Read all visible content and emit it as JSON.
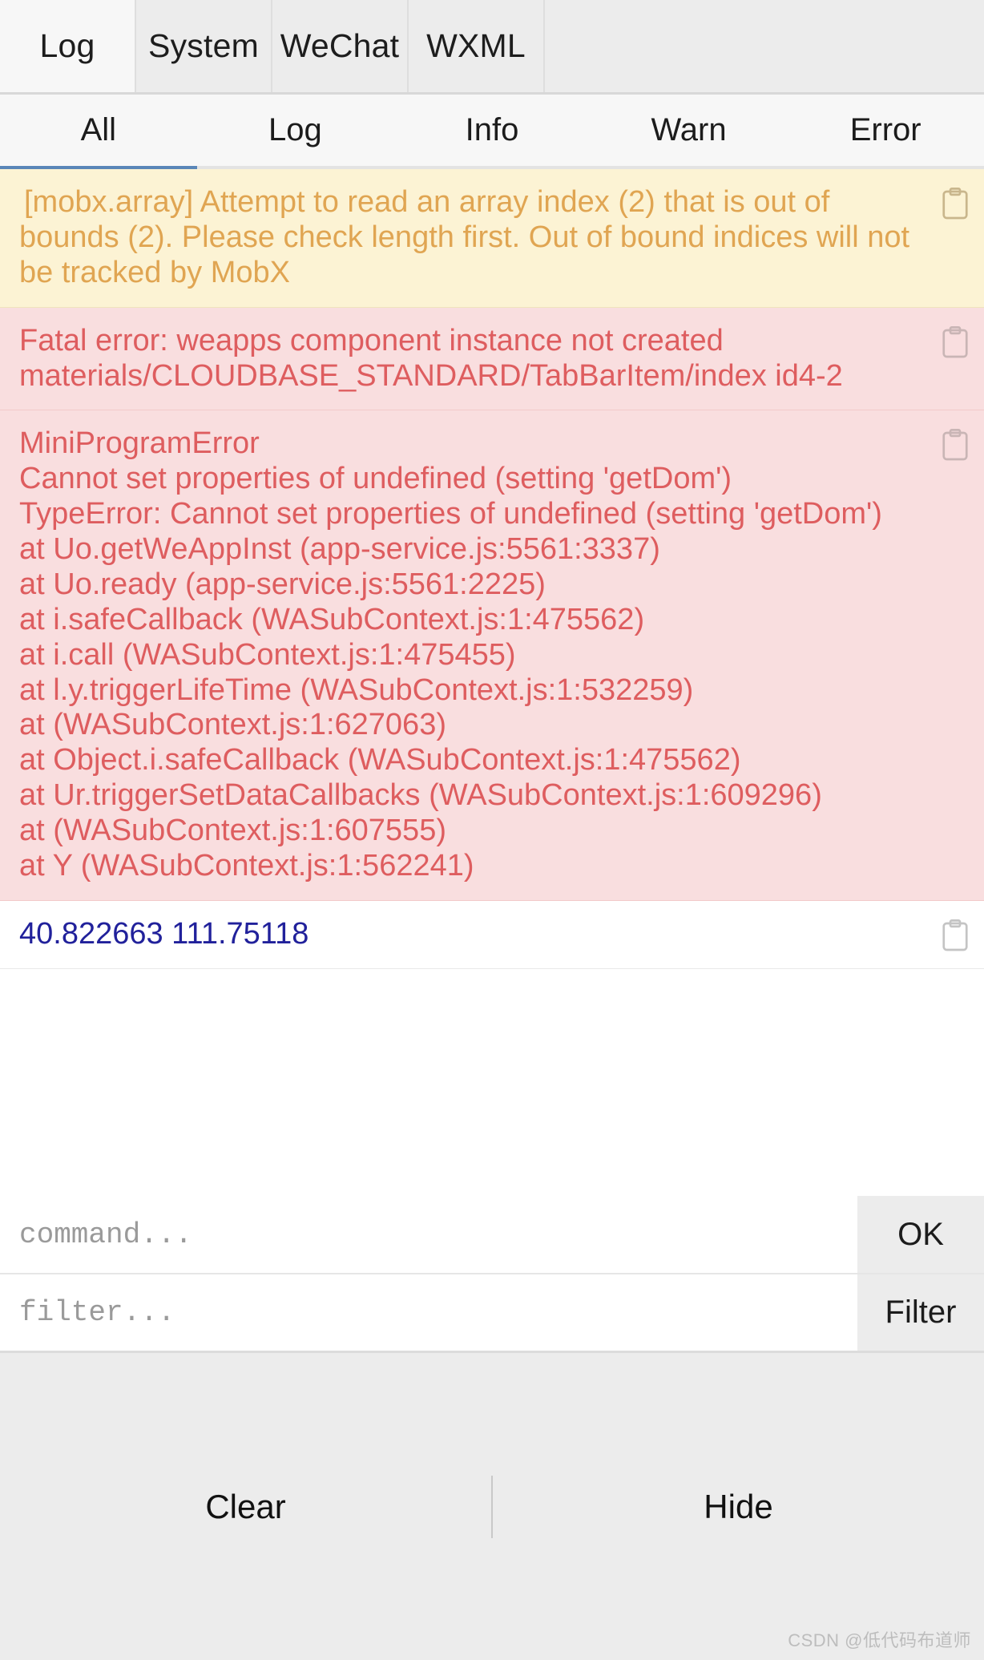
{
  "panel_tabs": [
    {
      "label": "Log",
      "active": true
    },
    {
      "label": "System",
      "active": false
    },
    {
      "label": "WeChat",
      "active": false
    },
    {
      "label": "WXML",
      "active": false
    }
  ],
  "level_tabs": [
    {
      "label": "All",
      "active": true
    },
    {
      "label": "Log",
      "active": false
    },
    {
      "label": "Info",
      "active": false
    },
    {
      "label": "Warn",
      "active": false
    },
    {
      "label": "Error",
      "active": false
    }
  ],
  "log_entries": [
    {
      "level": "warn",
      "text": "[mobx.array] Attempt to read an array index (2) that is out of bounds (2). Please check length first. Out of bound indices will not be tracked by MobX",
      "copy_icon": "clipboard-icon"
    },
    {
      "level": "error",
      "text": "Fatal error: weapps component instance not created materials/CLOUDBASE_STANDARD/TabBarItem/index id4-2",
      "copy_icon": "clipboard-icon"
    },
    {
      "level": "error",
      "text": "MiniProgramError\nCannot set properties of undefined (setting 'getDom')\nTypeError: Cannot set properties of undefined (setting 'getDom')\nat Uo.getWeAppInst (app-service.js:5561:3337)\nat Uo.ready (app-service.js:5561:2225)\nat i.safeCallback (WASubContext.js:1:475562)\nat i.call (WASubContext.js:1:475455)\nat l.y.triggerLifeTime (WASubContext.js:1:532259)\nat (WASubContext.js:1:627063)\nat Object.i.safeCallback (WASubContext.js:1:475562)\nat Ur.triggerSetDataCallbacks (WASubContext.js:1:609296)\nat (WASubContext.js:1:607555)\nat Y (WASubContext.js:1:562241)",
      "copy_icon": "clipboard-icon"
    },
    {
      "level": "plain",
      "text": "40.822663 111.75118",
      "copy_icon": "clipboard-icon"
    }
  ],
  "command_row": {
    "placeholder": "command...",
    "value": "",
    "action_label": "OK"
  },
  "filter_row": {
    "placeholder": "filter...",
    "value": "",
    "action_label": "Filter"
  },
  "bottom_bar": {
    "clear_label": "Clear",
    "hide_label": "Hide"
  },
  "watermark": "CSDN @低代码布道师",
  "colors": {
    "warn_bg": "#fcf3d4",
    "warn_text": "#e0a552",
    "error_bg": "#f9dedf",
    "error_text": "#de5d5f",
    "plain_text": "#21219b",
    "accent_underline": "#5a86b8",
    "chrome_gray": "#ececec"
  }
}
